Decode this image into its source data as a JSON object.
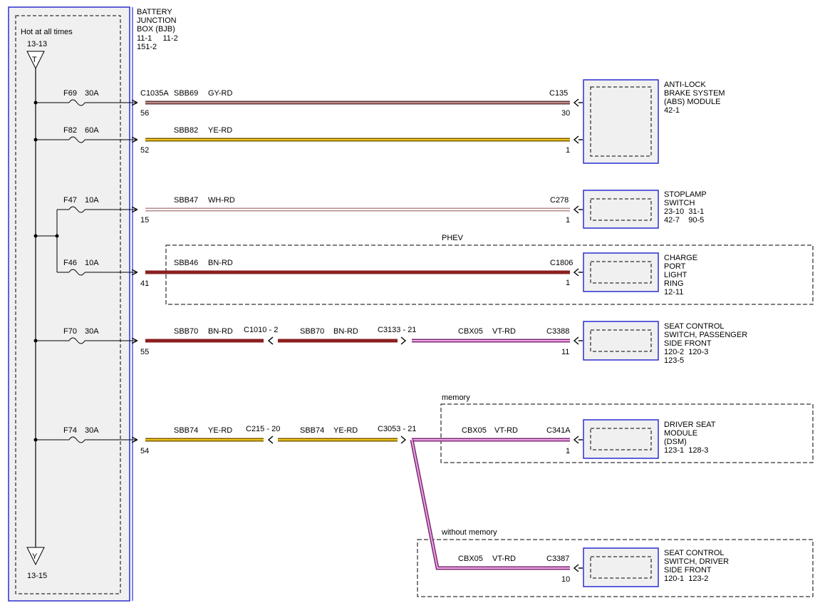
{
  "bjb": {
    "title_lines": [
      "BATTERY",
      "JUNCTION",
      "BOX (BJB)"
    ],
    "ref_lines": [
      "11-1     11-2",
      "151-2"
    ],
    "hot_label": "Hot at all times",
    "top_ref": "13-13",
    "top_tag": "T",
    "bottom_ref": "13-15",
    "bottom_tag": "Y"
  },
  "fuses": {
    "f69": {
      "id": "F69",
      "rating": "30A",
      "pin": "56"
    },
    "f82": {
      "id": "F82",
      "rating": "60A",
      "pin": "52"
    },
    "f47": {
      "id": "F47",
      "rating": "10A",
      "pin": "15"
    },
    "f46": {
      "id": "F46",
      "rating": "10A",
      "pin": "41"
    },
    "f70": {
      "id": "F70",
      "rating": "30A",
      "pin": "55"
    },
    "f74": {
      "id": "F74",
      "rating": "30A",
      "pin": "54"
    }
  },
  "circuits": {
    "c1": {
      "left_connector": "C1035A",
      "circuit": "SBB69",
      "color": "GY-RD",
      "right_connector": "C135",
      "right_pin": "30"
    },
    "c2": {
      "circuit": "SBB82",
      "color": "YE-RD",
      "right_pin": "1"
    },
    "c3": {
      "circuit": "SBB47",
      "color": "WH-RD",
      "right_connector": "C278",
      "right_pin": "1"
    },
    "c4": {
      "circuit": "SBB46",
      "color": "BN-RD",
      "right_connector": "C1806",
      "right_pin": "1"
    },
    "c5": {
      "circuit": "SBB70",
      "color": "BN-RD",
      "inline1": "C1010 - 2",
      "circuit2": "SBB70",
      "color2": "BN-RD",
      "inline2": "C3133 - 21",
      "circuit3": "CBX05",
      "color3": "VT-RD",
      "right_connector": "C3388",
      "right_pin": "11"
    },
    "c6": {
      "circuit": "SBB74",
      "color": "YE-RD",
      "inline1": "C215 - 20",
      "circuit2": "SBB74",
      "color2": "YE-RD",
      "inline2": "C3053 - 21",
      "circuit3": "CBX05",
      "color3": "VT-RD",
      "right_connector": "C341A",
      "right_pin": "1"
    },
    "c7": {
      "circuit": "CBX05",
      "color": "VT-RD",
      "right_connector": "C3387",
      "right_pin": "10"
    }
  },
  "options": {
    "phev": "PHEV",
    "memory": "memory",
    "without_memory": "without memory"
  },
  "components": {
    "abs": {
      "lines": [
        "ANTI-LOCK",
        "BRAKE SYSTEM",
        "(ABS) MODULE",
        "42-1"
      ]
    },
    "stoplamp": {
      "lines": [
        "STOPLAMP",
        "SWITCH",
        "23-10  31-1",
        "42-7    90-5"
      ]
    },
    "charge": {
      "lines": [
        "CHARGE",
        "PORT",
        "LIGHT",
        "RING",
        "12-11"
      ]
    },
    "seat_pass": {
      "lines": [
        "SEAT CONTROL",
        "SWITCH, PASSENGER",
        "SIDE FRONT",
        "120-2  120-3",
        "123-5"
      ]
    },
    "dsm": {
      "lines": [
        "DRIVER SEAT",
        "MODULE",
        "(DSM)",
        "123-1  128-3"
      ]
    },
    "seat_drv": {
      "lines": [
        "SEAT CONTROL",
        "SWITCH, DRIVER",
        "SIDE FRONT",
        "120-1  123-2"
      ]
    }
  },
  "colors": {
    "module_border": "#2b2fd0",
    "box_fill": "#f0f0f0",
    "gy_rd": "#b06868",
    "ye_rd": "#e9c11a",
    "wh_rd": "#d9a7a7",
    "bn_rd": "#8a1f1f",
    "vt_rd": "#e07ad6"
  }
}
